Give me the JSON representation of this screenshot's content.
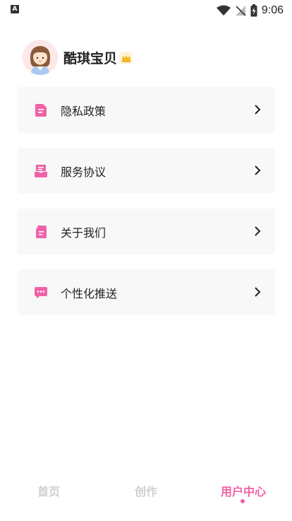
{
  "statusbar": {
    "time": "9:06",
    "left_icon": "A"
  },
  "profile": {
    "username": "酷琪宝贝",
    "badge_icon": "crown-icon"
  },
  "menu": [
    {
      "label": "隐私政策",
      "icon": "document-icon"
    },
    {
      "label": "服务协议",
      "icon": "inbox-icon"
    },
    {
      "label": "关于我们",
      "icon": "info-card-icon"
    },
    {
      "label": "个性化推送",
      "icon": "chat-bubble-icon"
    }
  ],
  "tabs": [
    {
      "label": "首页",
      "active": false
    },
    {
      "label": "创作",
      "active": false
    },
    {
      "label": "用户中心",
      "active": true
    }
  ],
  "colors": {
    "accent": "#f062a8",
    "card_bg": "#f8f8f8",
    "tab_inactive": "#cfcfcf"
  }
}
